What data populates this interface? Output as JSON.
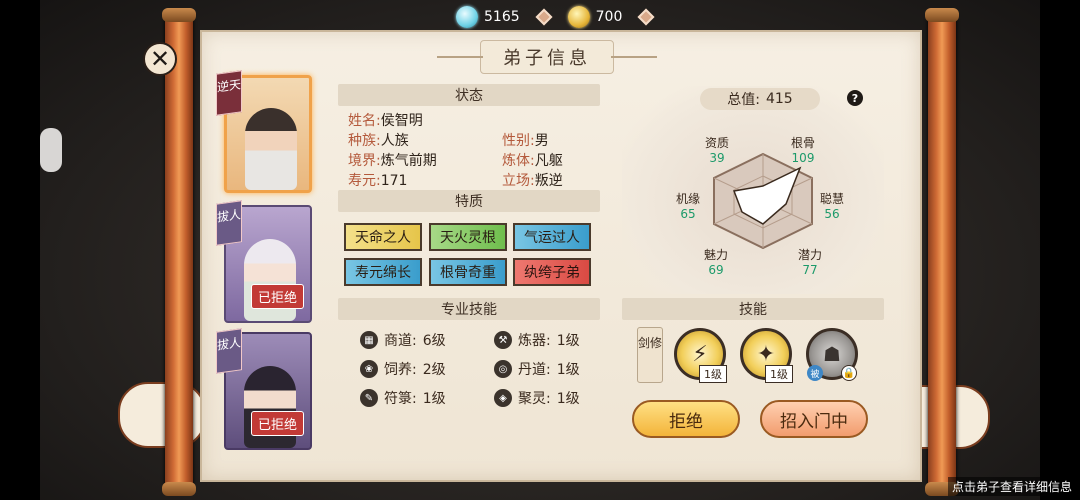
{
  "currency": {
    "jade": "5165",
    "gold": "700"
  },
  "title": "弟子信息",
  "disciples": [
    {
      "rank": "逆天",
      "selected": true,
      "stamp": ""
    },
    {
      "rank": "拔人",
      "selected": false,
      "stamp": "已拒绝"
    },
    {
      "rank": "拔人",
      "selected": false,
      "stamp": "已拒绝"
    }
  ],
  "status": {
    "header": "状态",
    "name_label": "姓名:",
    "name": "侯智明",
    "race_label": "种族:",
    "race": "人族",
    "gender_label": "性别:",
    "gender": "男",
    "realm_label": "境界:",
    "realm": "炼气前期",
    "body_label": "炼体:",
    "body": "凡躯",
    "life_label": "寿元:",
    "life": "171",
    "stance_label": "立场:",
    "stance": "叛逆"
  },
  "traits": {
    "header": "特质",
    "items": [
      {
        "label": "天命之人",
        "color": "#e6c54a"
      },
      {
        "label": "天火灵根",
        "color": "#6fbe4d"
      },
      {
        "label": "气运过人",
        "color": "#3a9dcc"
      },
      {
        "label": "寿元绵长",
        "color": "#3a9dcc"
      },
      {
        "label": "根骨奇重",
        "color": "#3a9dcc"
      },
      {
        "label": "纨绔子弟",
        "color": "#d94a43"
      }
    ]
  },
  "professions": {
    "header": "专业技能",
    "items": [
      {
        "label": "商道:",
        "level": "6级",
        "icon": "merchant-icon"
      },
      {
        "label": "炼器:",
        "level": "1级",
        "icon": "forge-icon"
      },
      {
        "label": "饲养:",
        "level": "2级",
        "icon": "breeding-icon"
      },
      {
        "label": "丹道:",
        "level": "1级",
        "icon": "alchemy-icon"
      },
      {
        "label": "符箓:",
        "level": "1级",
        "icon": "talisman-icon"
      },
      {
        "label": "聚灵:",
        "level": "1级",
        "icon": "gather-spirit-icon"
      }
    ]
  },
  "attributes": {
    "total_label": "总值:",
    "total": "415",
    "stats": [
      {
        "label": "资质",
        "value": "39"
      },
      {
        "label": "根骨",
        "value": "109"
      },
      {
        "label": "聪慧",
        "value": "56"
      },
      {
        "label": "潜力",
        "value": "77"
      },
      {
        "label": "魅力",
        "value": "69"
      },
      {
        "label": "机缘",
        "value": "65"
      }
    ]
  },
  "skills": {
    "header": "技能",
    "path_label": "剑修",
    "items": [
      {
        "level": "1级",
        "locked": false
      },
      {
        "level": "1级",
        "locked": false
      },
      {
        "level": "",
        "locked": true
      }
    ]
  },
  "buttons": {
    "reject": "拒绝",
    "recruit": "招入门中"
  },
  "hint": "点击弟子查看详细信息"
}
